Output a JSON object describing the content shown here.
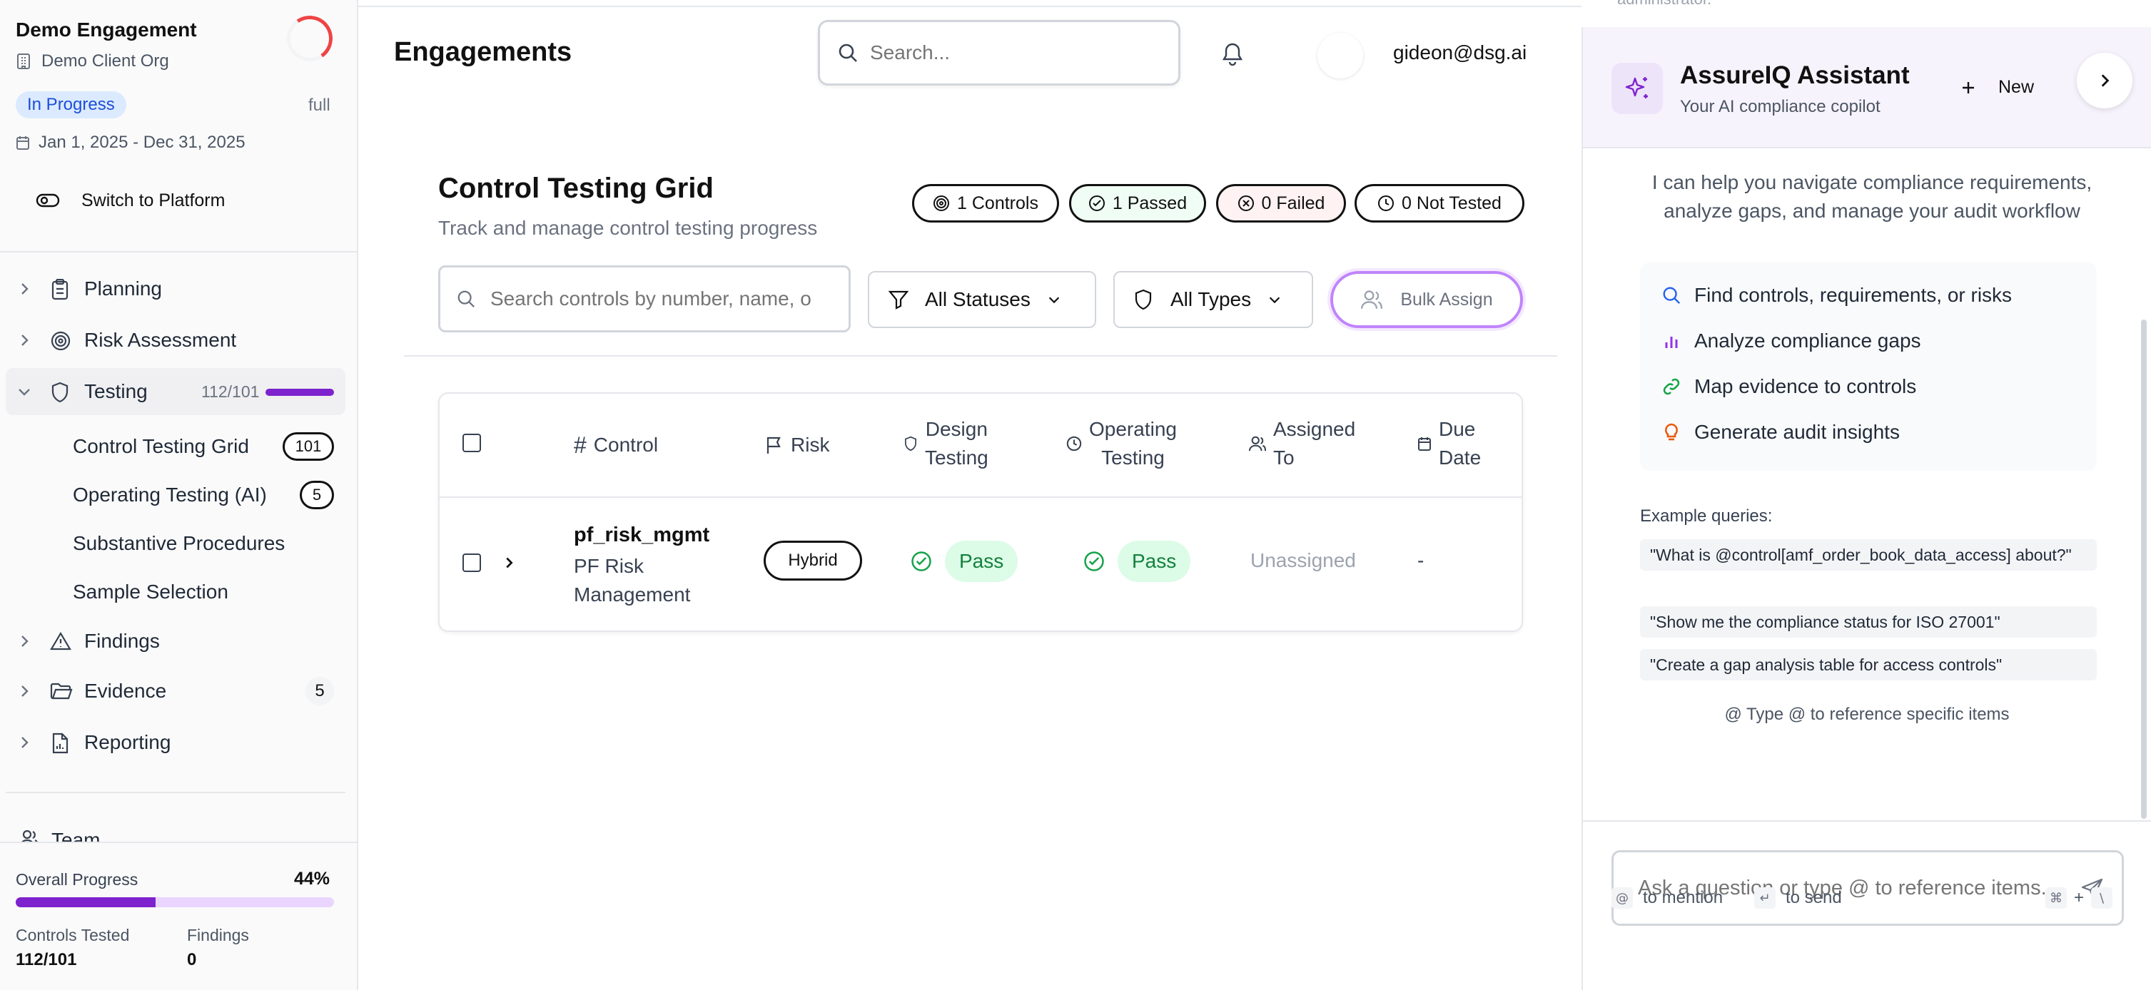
{
  "engagement": {
    "title": "Demo Engagement",
    "org": "Demo Client Org",
    "status": "In Progress",
    "scope": "full",
    "date_range": "Jan 1, 2025 - Dec 31, 2025",
    "switch_label": "Switch to Platform"
  },
  "nav": {
    "planning": "Planning",
    "risk_assessment": "Risk Assessment",
    "testing": "Testing",
    "testing_count": "112/101",
    "sub": {
      "control_testing_grid": "Control Testing Grid",
      "control_testing_grid_count": "101",
      "operating_testing_ai": "Operating Testing (AI)",
      "operating_testing_ai_count": "5",
      "substantive": "Substantive Procedures",
      "sample_selection": "Sample Selection"
    },
    "findings": "Findings",
    "evidence": "Evidence",
    "evidence_count": "5",
    "reporting": "Reporting",
    "team": "Team"
  },
  "progress": {
    "label": "Overall Progress",
    "percent_text": "44%",
    "fraction": 0.44,
    "controls_tested_label": "Controls Tested",
    "controls_tested_value": "112/101",
    "findings_label": "Findings",
    "findings_value": "0"
  },
  "header": {
    "title": "Engagements",
    "search_placeholder": "Search...",
    "user_email": "gideon@dsg.ai"
  },
  "grid": {
    "title": "Control Testing Grid",
    "subtitle": "Track and manage control testing progress",
    "stats": {
      "controls": "1 Controls",
      "passed": "1 Passed",
      "failed": "0 Failed",
      "not_tested": "0 Not Tested"
    },
    "filter_placeholder": "Search controls by number, name, o",
    "status_filter": "All Statuses",
    "type_filter": "All Types",
    "bulk_assign": "Bulk Assign"
  },
  "table": {
    "headers": {
      "control": "Control",
      "risk": "Risk",
      "design_1": "Design",
      "design_2": "Testing",
      "operating_1": "Operating",
      "operating_2": "Testing",
      "assigned_1": "Assigned",
      "assigned_2": "To",
      "due_1": "Due",
      "due_2": "Date"
    },
    "rows": [
      {
        "id": "pf_risk_mgmt",
        "name": "PF Risk Management",
        "risk": "Hybrid",
        "design": "Pass",
        "operating": "Pass",
        "assigned": "Unassigned",
        "due": "-"
      }
    ]
  },
  "assistant": {
    "top_fragment": "administrator.",
    "title": "AssureIQ Assistant",
    "subtitle": "Your AI compliance copilot",
    "new_label": "New",
    "intro": "I can help you navigate compliance requirements, analyze gaps, and manage your audit workflow",
    "capabilities": [
      "Find controls, requirements, or risks",
      "Analyze compliance gaps",
      "Map evidence to controls",
      "Generate audit insights"
    ],
    "examples_label": "Example queries:",
    "examples": [
      "\"What is @control[amf_order_book_data_access] about?\"",
      "\"Show me the compliance status for ISO 27001\"",
      "\"Create a gap analysis table for access controls\""
    ],
    "mention_hint": "@ Type @ to reference specific items",
    "input_placeholder": "Ask a question or type @ to reference items...",
    "hint_mention_key": "@",
    "hint_mention": "to mention",
    "hint_send_key": "↵",
    "hint_send": "to send",
    "hint_cmd": "⌘",
    "hint_plus": "+",
    "hint_backslash": "\\"
  },
  "colors": {
    "accent_purple": "#7e22ce",
    "status_blue_bg": "#dbeafe",
    "pass_green": "#15803d",
    "assistant_header_bg": "#f7f3fc"
  }
}
